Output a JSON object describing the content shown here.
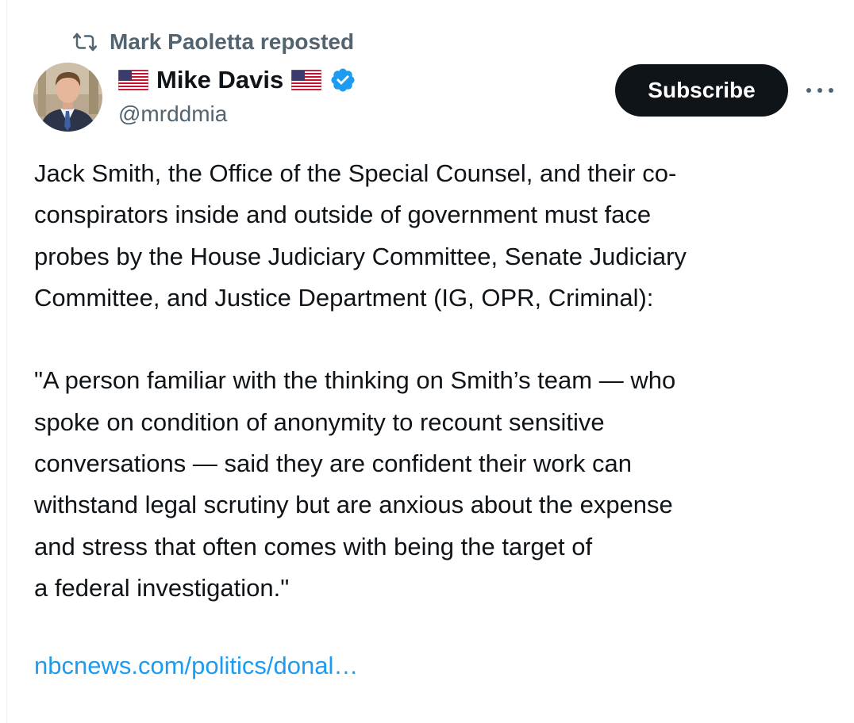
{
  "repost": {
    "label": "Mark Paoletta reposted",
    "icon": "repost-icon"
  },
  "author": {
    "name": "Mike Davis",
    "handle": "@mrddmia",
    "verified": true,
    "name_emoji_left": "us-flag",
    "name_emoji_right": "us-flag"
  },
  "actions": {
    "subscribe_label": "Subscribe",
    "more_icon": "more-icon"
  },
  "tweet": {
    "lines_para1": [
      "Jack Smith, the Office of the Special Counsel, and their co-",
      "conspirators inside and outside of government must face",
      "probes by the House Judiciary Committee, Senate Judiciary",
      "Committee, and Justice Department (IG, OPR, Criminal):"
    ],
    "lines_para2": [
      "\"A person familiar with the thinking on Smith’s team — who",
      "spoke on condition of anonymity to recount sensitive",
      "conversations — said they are confident their work can",
      "withstand legal scrutiny but are anxious about the expense",
      "and stress that often comes with being the target of",
      "a federal investigation.\""
    ],
    "link_text": "nbcnews.com/politics/donal…"
  },
  "colors": {
    "text": "#0f1419",
    "muted": "#536471",
    "link": "#1d9bf0",
    "verified": "#1d9bf0",
    "button_bg": "#0f1419"
  }
}
